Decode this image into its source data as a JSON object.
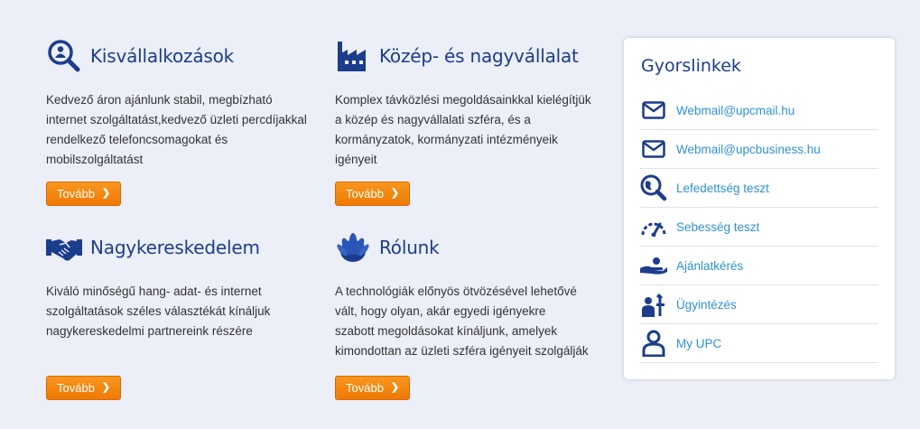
{
  "cards": [
    {
      "title": "Kisvállalkozások",
      "icon": "search-person-icon",
      "lines": [
        "Kedvező áron ajánlunk stabil, megbízható",
        "internet szolgáltatást,kedvező üzleti percdíjakkal",
        "rendelkező telefoncsomagokat és",
        "mobilszolgáltatást"
      ],
      "button": "Tovább"
    },
    {
      "title": "Közép- és nagyvállalat",
      "icon": "factory-icon",
      "lines": [
        "Komplex távközlési megoldásainkkal kielégítjük",
        "a közép és nagyvállalati szféra, és a",
        "kormányzatok, kormányzati intézményeik",
        "igényeit"
      ],
      "button": "Tovább"
    },
    {
      "title": "Nagykereskedelem",
      "icon": "handshake-icon",
      "lines": [
        "Kiváló minőségű hang- adat- és internet",
        "szolgáltatások széles választékát kínáljuk",
        "nagykereskedelmi partnereink részére"
      ],
      "button": "Tovább"
    },
    {
      "title": "Rólunk",
      "icon": "upc-logo-icon",
      "lines": [
        "A technológiák előnyös ötvözésével lehetővé",
        "vált, hogy olyan, akár egyedi igényekre",
        "szabott megoldásokat kínáljunk, amelyek",
        "kimondottan az üzleti szféra igényeit szolgálják"
      ],
      "button": "Tovább"
    }
  ],
  "quicklinks": {
    "title": "Gyorslinkek",
    "items": [
      {
        "label": "Webmail@upcmail.hu",
        "icon": "envelope-icon"
      },
      {
        "label": "Webmail@upcbusiness.hu",
        "icon": "envelope-icon"
      },
      {
        "label": "Lefedettség teszt",
        "icon": "globe-search-icon"
      },
      {
        "label": "Sebesség teszt",
        "icon": "speedometer-icon"
      },
      {
        "label": "Ajánlatkérés",
        "icon": "hand-offer-icon"
      },
      {
        "label": "Ügyintézés",
        "icon": "service-person-icon"
      },
      {
        "label": "My UPC",
        "icon": "user-icon"
      }
    ]
  },
  "colors": {
    "accent": "#1b3d8c",
    "button": "#f58a12",
    "link": "#2f92d6",
    "background": "#eceef8"
  }
}
